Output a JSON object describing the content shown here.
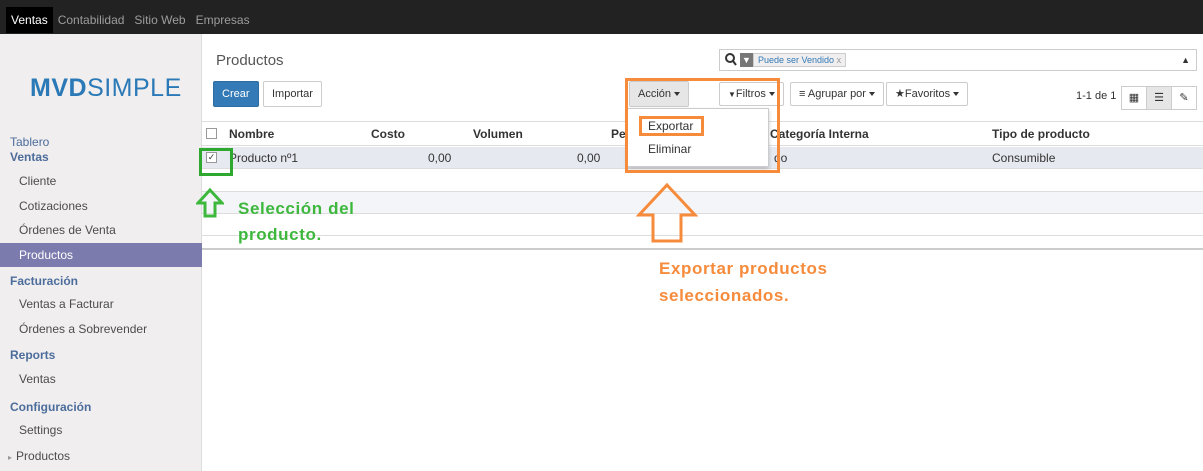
{
  "topbar": {
    "tabs": [
      "Ventas",
      "Contabilidad",
      "Sitio Web",
      "Empresas"
    ]
  },
  "logo": {
    "bold": "MVD",
    "light": "SIMPLE"
  },
  "sidebar": {
    "tablero": "Tablero",
    "ventas_section": "Ventas",
    "items_ventas": [
      "Cliente",
      "Cotizaciones",
      "Órdenes de Venta",
      "Productos"
    ],
    "facturacion": "Facturación",
    "items_facturacion": [
      "Ventas a Facturar",
      "Órdenes a Sobrevender"
    ],
    "reports": "Reports",
    "items_reports": [
      "Ventas"
    ],
    "configuracion": "Configuración",
    "items_config": [
      "Settings",
      "Productos"
    ]
  },
  "main": {
    "title": "Productos",
    "crear": "Crear",
    "importar": "Importar",
    "accion": "Acción",
    "filtros": "Filtros",
    "agrupar": "Agrupar por",
    "favoritos": "Favoritos",
    "pager": "1-1 de 1",
    "search_facet": "Puede ser Vendido",
    "columns": [
      "Nombre",
      "Costo",
      "Volumen",
      "Pe",
      "Categoría Interna",
      "Tipo de producto"
    ],
    "row": {
      "nombre": "Producto nº1",
      "costo": "0,00",
      "volumen": "0,00",
      "categoria": "do",
      "tipo": "Consumible"
    },
    "dropdown": [
      "Exportar",
      "Eliminar"
    ]
  },
  "annotations": {
    "seleccion_line1": "Selección del",
    "seleccion_line2": "producto.",
    "exportar_line1": "Exportar productos",
    "exportar_line2": "seleccionados."
  },
  "colors": {
    "accent": "#337ab7",
    "orange": "#f68b3c",
    "green": "#3db83d",
    "active_menu": "#7c7bad"
  }
}
